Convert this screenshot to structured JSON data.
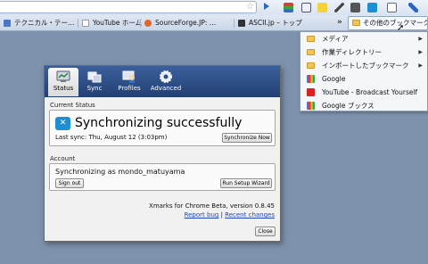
{
  "bookmarks": [
    {
      "label": "テクニカル・テー…",
      "color": "#4a78c8"
    },
    {
      "label": "YouTube ホーム",
      "color": "#ffffff"
    },
    {
      "label": "SourceForge.JP: …",
      "color": "#e0672a"
    },
    {
      "label": "ASCII.jp – トップ",
      "color": "#333333"
    }
  ],
  "overflow_label": "»",
  "other_bookmarks": "その他のブックマーク",
  "menu": {
    "items": [
      {
        "label": "メディア",
        "type": "folder"
      },
      {
        "label": "作業ディレクトリー",
        "type": "folder"
      },
      {
        "label": "インポートしたブックマーク",
        "type": "folder"
      },
      {
        "label": "Google",
        "type": "google"
      },
      {
        "label": "YouTube - Broadcast Yourself",
        "type": "youtube"
      },
      {
        "label": "Google ブックス",
        "type": "google"
      }
    ]
  },
  "dialog": {
    "tabs": [
      {
        "label": "Status"
      },
      {
        "label": "Sync"
      },
      {
        "label": "Profiles"
      },
      {
        "label": "Advanced"
      }
    ],
    "current_status": {
      "title": "Current Status",
      "headline": "Synchronizing successfully",
      "last_sync": "Last sync: Thu, August 12 (3:03pm)",
      "button": "Synchronize Now"
    },
    "account": {
      "title": "Account",
      "text": "Synchronizing as mondo_matuyama",
      "sign_out": "Sign out",
      "wizard": "Run Setup Wizard"
    },
    "version": "Xmarks for Chrome Beta, version 0.8.45",
    "report_bug": "Report bug",
    "separator": "|",
    "recent_changes": "Recent changes",
    "close": "Close"
  },
  "colors": {
    "desktop": "#7d92ad",
    "header": "#2e4f88",
    "accent": "#1d8fd4"
  }
}
